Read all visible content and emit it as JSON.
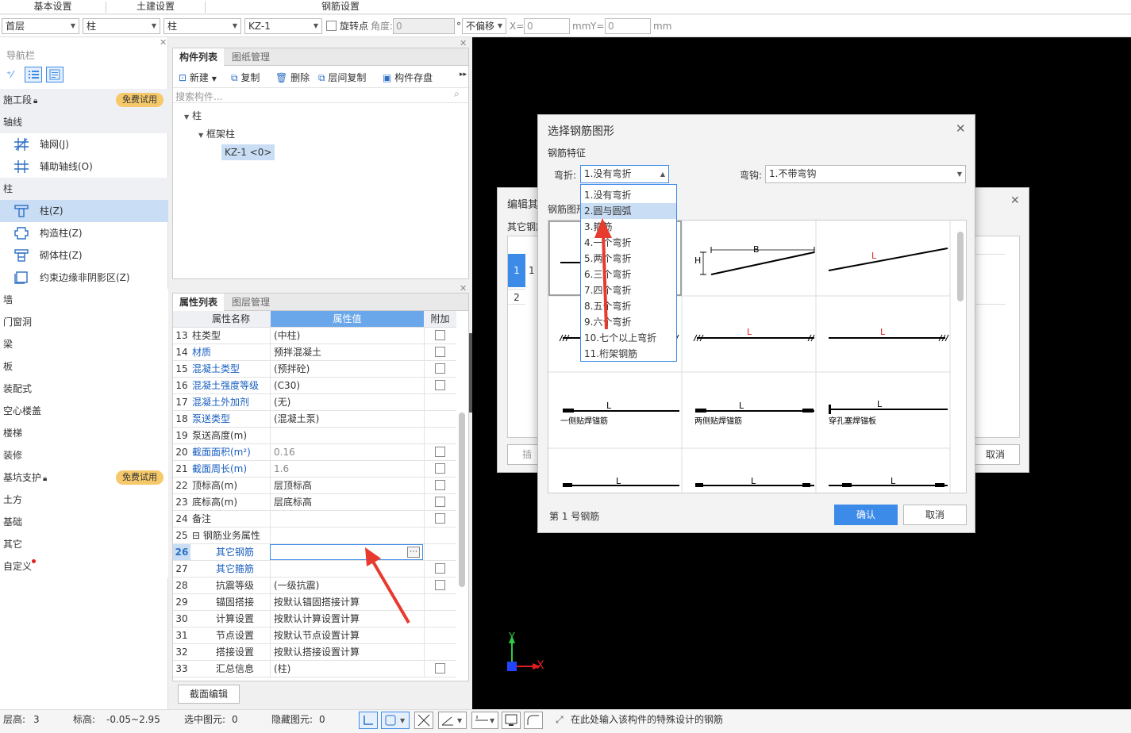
{
  "top_tabs": [
    "基本设置",
    "土建设置",
    "钢筋设置"
  ],
  "toolbar": {
    "floor": "首层",
    "category": "柱",
    "subcategory": "柱",
    "component": "KZ-1",
    "rotate_label": "旋转点",
    "angle_label": "角度:",
    "angle_value": "0",
    "degree_unit": "°",
    "offset": "不偏移",
    "x_label": "X=",
    "x_value": "0",
    "mm1": "mm",
    "y_label": "Y=",
    "y_value": "0",
    "mm2": "mm"
  },
  "nav": {
    "title": "导航栏",
    "sections": [
      {
        "label": "施工段",
        "badge": "免费试用"
      },
      {
        "label": "轴线"
      },
      {
        "label": "柱"
      },
      {
        "label": "墙"
      },
      {
        "label": "门窗洞"
      },
      {
        "label": "梁"
      },
      {
        "label": "板"
      },
      {
        "label": "装配式"
      },
      {
        "label": "空心楼盖"
      },
      {
        "label": "楼梯"
      },
      {
        "label": "装修"
      },
      {
        "label": "基坑支护",
        "badge": "免费试用"
      },
      {
        "label": "土方"
      },
      {
        "label": "基础"
      },
      {
        "label": "其它"
      },
      {
        "label": "自定义"
      }
    ],
    "axis_items": [
      "轴网(J)",
      "辅助轴线(O)"
    ],
    "column_items": [
      "柱(Z)",
      "构造柱(Z)",
      "砌体柱(Z)",
      "约束边缘非阴影区(Z)"
    ]
  },
  "component_panel": {
    "tabs": [
      "构件列表",
      "图纸管理"
    ],
    "actions": [
      "新建",
      "复制",
      "删除",
      "层间复制",
      "构件存盘"
    ],
    "search_placeholder": "搜索构件...",
    "tree": {
      "root": "柱",
      "child": "框架柱",
      "leaf": "KZ-1 <0>"
    }
  },
  "property_panel": {
    "tabs": [
      "属性列表",
      "图层管理"
    ],
    "headers": [
      "属性名称",
      "属性值",
      "附加"
    ],
    "rows": [
      {
        "n": "13",
        "k": "柱类型",
        "v": "(中柱)",
        "blue": false,
        "cb": true
      },
      {
        "n": "14",
        "k": "材质",
        "v": "预拌混凝土",
        "blue": true,
        "cb": true
      },
      {
        "n": "15",
        "k": "混凝土类型",
        "v": "(预拌砼)",
        "blue": true,
        "cb": true
      },
      {
        "n": "16",
        "k": "混凝土强度等级",
        "v": "(C30)",
        "blue": true,
        "cb": true
      },
      {
        "n": "17",
        "k": "混凝土外加剂",
        "v": "(无)",
        "blue": true,
        "cb": false
      },
      {
        "n": "18",
        "k": "泵送类型",
        "v": "(混凝土泵)",
        "blue": true,
        "cb": false
      },
      {
        "n": "19",
        "k": "泵送高度(m)",
        "v": "",
        "blue": false,
        "cb": false
      },
      {
        "n": "20",
        "k": "截面面积(m²)",
        "v": "0.16",
        "blue": true,
        "cb": true
      },
      {
        "n": "21",
        "k": "截面周长(m)",
        "v": "1.6",
        "blue": true,
        "cb": true
      },
      {
        "n": "22",
        "k": "顶标高(m)",
        "v": "层顶标高",
        "blue": false,
        "cb": true
      },
      {
        "n": "23",
        "k": "底标高(m)",
        "v": "层底标高",
        "blue": false,
        "cb": true
      },
      {
        "n": "24",
        "k": "备注",
        "v": "",
        "blue": false,
        "cb": true
      },
      {
        "n": "25",
        "k": "钢筋业务属性",
        "v": "",
        "blue": false,
        "cb": false
      },
      {
        "n": "26",
        "k": "其它钢筋",
        "v": "",
        "blue": true,
        "cb": false
      },
      {
        "n": "27",
        "k": "其它箍筋",
        "v": "",
        "blue": true,
        "cb": true
      },
      {
        "n": "28",
        "k": "抗震等级",
        "v": "(一级抗震)",
        "blue": false,
        "cb": true
      },
      {
        "n": "29",
        "k": "锚固搭接",
        "v": "按默认锚固搭接计算",
        "blue": false,
        "cb": false
      },
      {
        "n": "30",
        "k": "计算设置",
        "v": "按默认计算设置计算",
        "blue": false,
        "cb": false
      },
      {
        "n": "31",
        "k": "节点设置",
        "v": "按默认节点设置计算",
        "blue": false,
        "cb": false
      },
      {
        "n": "32",
        "k": "搭接设置",
        "v": "按默认搭接设置计算",
        "blue": false,
        "cb": false
      },
      {
        "n": "33",
        "k": "汇总信息",
        "v": "(柱)",
        "blue": false,
        "cb": true
      }
    ],
    "section_edit_button": "截面编辑"
  },
  "edit_dialog": {
    "title": "编辑其",
    "label": "其它钢筋",
    "rows": [
      "1",
      "2"
    ],
    "cell": "1",
    "insert": "插",
    "cancel": "取消"
  },
  "shape_dialog": {
    "title": "选择钢筋图形",
    "feature_label": "钢筋特征",
    "bend_label": "弯折:",
    "bend_value": "1.没有弯折",
    "hook_label": "弯钩:",
    "hook_value": "1.不带弯钩",
    "shape_label": "钢筋图形",
    "bend_options": [
      "1.没有弯折",
      "2.圆与圆弧",
      "3.箍筋",
      "4.一个弯折",
      "5.两个弯折",
      "6.三个弯折",
      "7.四个弯折",
      "8.五个弯折",
      "9.六个弯折",
      "10.七个以上弯折",
      "11.桁架钢筋"
    ],
    "shape_texts": {
      "B": "B",
      "H": "H",
      "L": "L",
      "one_side": "一侧贴焊锚筋",
      "two_side": "两侧贴焊锚筋",
      "pass_plate": "穿孔塞焊锚板"
    },
    "footer": "第 1 号钢筋",
    "ok": "确认",
    "cancel": "取消"
  },
  "axes": {
    "x": "X",
    "y": "Y"
  },
  "status": {
    "floor_h": "层高:",
    "floor_h_val": "3",
    "elev": "标高:",
    "elev_val": "-0.05~2.95",
    "sel": "选中图元:",
    "sel_val": "0",
    "hidden": "隐藏图元:",
    "hidden_val": "0",
    "hint": "在此处输入该构件的特殊设计的钢筋"
  },
  "colors": {
    "accent": "#3d8be8",
    "badge": "#f5c96a",
    "highlight": "#c9def5",
    "arrow": "#e63b2e"
  }
}
